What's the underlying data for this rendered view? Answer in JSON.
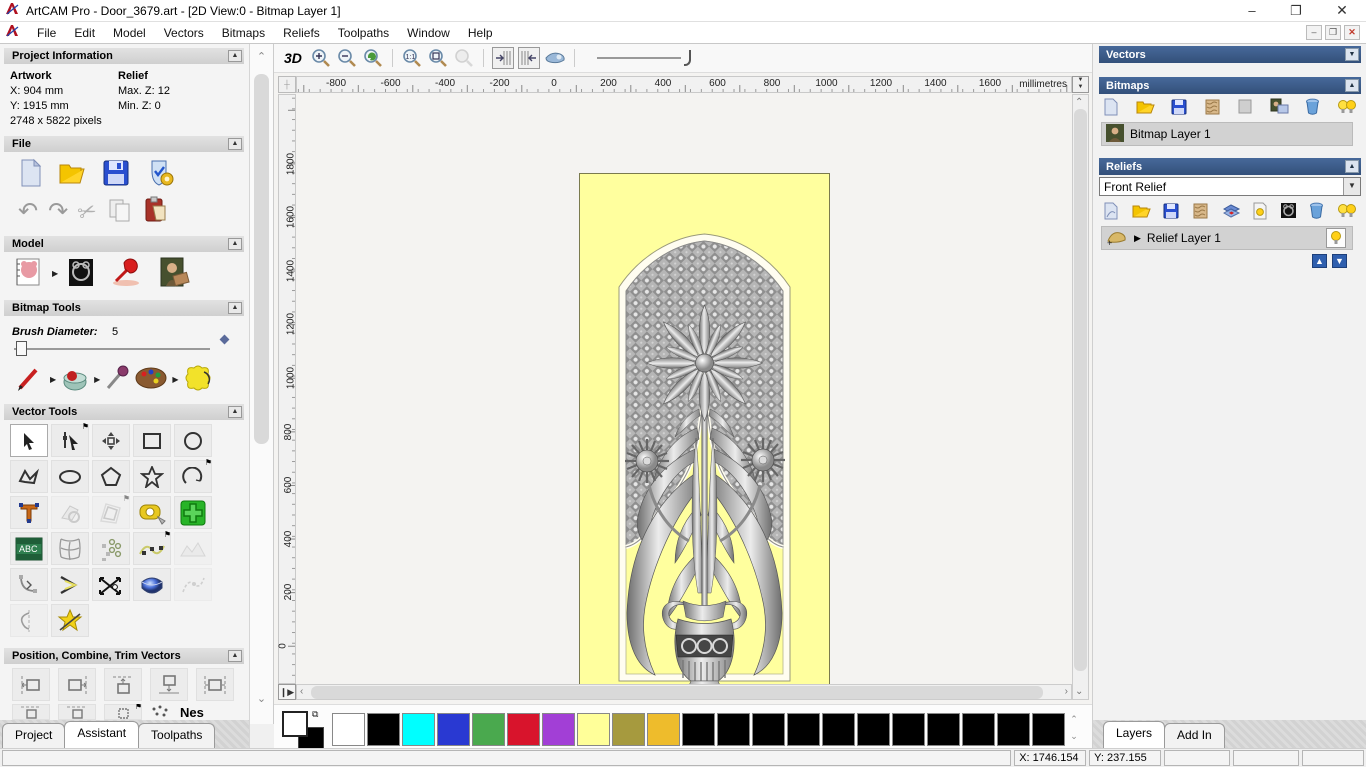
{
  "window": {
    "title": "ArtCAM Pro - Door_3679.art - [2D View:0 - Bitmap Layer 1]",
    "controls": {
      "minimize": "–",
      "restore": "❐",
      "close": "✕"
    },
    "mdi_controls": {
      "minimize": "–",
      "restore": "❐",
      "close": "✕"
    }
  },
  "menu": {
    "items": [
      "File",
      "Edit",
      "Model",
      "Vectors",
      "Bitmaps",
      "Reliefs",
      "Toolpaths",
      "Window",
      "Help"
    ]
  },
  "left_panel": {
    "project_information": {
      "title": "Project Information",
      "artwork_label": "Artwork",
      "relief_label": "Relief",
      "x_value": "X: 904 mm",
      "y_value": "Y: 1915 mm",
      "max_z": "Max. Z: 12",
      "min_z": "Min. Z: 0",
      "pixels": "2748 x 5822 pixels"
    },
    "file": {
      "title": "File",
      "icons": [
        "new-model-icon",
        "open-model-icon",
        "save-model-icon",
        "model-options-icon",
        "undo-icon",
        "redo-icon",
        "cut-icon",
        "copy-icon",
        "paste-icon"
      ]
    },
    "model": {
      "title": "Model",
      "icons": [
        "set-model-size-icon",
        "invert-model-icon",
        "set-lighting-icon",
        "load-bitmap-icon"
      ]
    },
    "bitmap_tools": {
      "title": "Bitmap Tools",
      "brush_diameter_label": "Brush Diameter:",
      "brush_diameter_value": "5",
      "icons": [
        "paint-icon",
        "paint-bucket-icon",
        "pick-colour-icon",
        "colour-palette-icon",
        "texture-flood-icon"
      ]
    },
    "vector_tools": {
      "title": "Vector Tools",
      "icons": [
        "select-vectors",
        "node-editing",
        "transform-vectors",
        "create-rectangle",
        "create-circle",
        "create-polyline",
        "create-ellipse",
        "create-polygon",
        "create-star",
        "create-arc",
        "create-text",
        "vector-doctor",
        "offset-vector",
        "measure",
        "block-copy-rotate",
        "text-on-curve",
        "envelope-distort",
        "paste-along-curve",
        "fit-points-to-curve",
        "free-relief",
        "fillet-curves",
        "join-vectors",
        "trim-vectors",
        "interactive-extrude",
        "spline-faded",
        "mirror-merge",
        "slice-vectors"
      ]
    },
    "position_combine": {
      "title": "Position, Combine, Trim Vectors",
      "icons": [
        "align-left",
        "align-right",
        "align-top",
        "align-bottom",
        "align-centre",
        "centre-x",
        "centre-y",
        "centre-page",
        "nesting"
      ],
      "overflow_text": "Nes"
    },
    "tabs": [
      "Project",
      "Assistant",
      "Toolpaths"
    ],
    "active_tab": "Assistant"
  },
  "canvas": {
    "toolbar": {
      "threed_label": "3D",
      "icons": [
        "zoom-in-icon",
        "zoom-out-icon",
        "zoom-previous-icon",
        "zoom-1to1-icon",
        "zoom-fit-icon",
        "zoom-object-icon",
        "snap-left-icon",
        "snap-right-icon",
        "redraw-icon",
        "contrast-slider"
      ]
    },
    "h_ruler": {
      "labels": [
        -800,
        -600,
        -400,
        -200,
        0,
        200,
        400,
        600,
        800,
        1000,
        1200,
        1400,
        1600
      ],
      "unit": "millimetres"
    },
    "v_ruler": {
      "labels": [
        1800,
        1600,
        1400,
        1200,
        1000,
        800,
        600,
        400,
        200,
        0
      ]
    },
    "door_artwork": {
      "background": "#ffff9e",
      "description": "grayscale floral relief door panel with multifoil arch, lattice, flower bouquet and vase"
    }
  },
  "right_panel": {
    "vectors": {
      "title": "Vectors"
    },
    "bitmaps": {
      "title": "Bitmaps",
      "layer_name": "Bitmap Layer 1",
      "icons": [
        "new-layer-icon",
        "open-layer-icon",
        "save-layer-icon",
        "texture-layer-icon",
        "blank-layer-icon",
        "bitmap-to-layer-icon",
        "delete-layer-icon",
        "toggle-visibility-icon"
      ]
    },
    "reliefs": {
      "title": "Reliefs",
      "dropdown_value": "Front Relief",
      "layer_name": "Relief Layer 1",
      "icons": [
        "new-layer-icon",
        "open-layer-icon",
        "save-layer-icon",
        "texture-layer-icon",
        "merge-relief-icon",
        "layer-visibility-icon",
        "greyscale-layer-icon",
        "delete-layer-icon",
        "toggle-visibility-icon"
      ]
    },
    "tabs": [
      "Layers",
      "Add In"
    ],
    "active_tab": "Layers"
  },
  "status_bar": {
    "fields": [
      "",
      "X: 1746.154",
      "Y: 237.155",
      "",
      "",
      ""
    ]
  },
  "palette": {
    "colors": [
      "#ffffff",
      "#000000",
      "#00ffff",
      "#2939d2",
      "#4aa94e",
      "#d8142c",
      "#a23fd6",
      "#ffff99",
      "#a69a3e",
      "#eebc2c",
      "#000000",
      "#000000",
      "#000000",
      "#000000",
      "#000000",
      "#000000",
      "#000000",
      "#000000",
      "#000000",
      "#000000",
      "#000000"
    ],
    "primary": "#ffffff",
    "secondary": "#000000"
  },
  "theme": {
    "header_blue": "#3a5a7e",
    "door_yellow": "#ffff9e",
    "selection_gray": "#d2d2d2"
  }
}
